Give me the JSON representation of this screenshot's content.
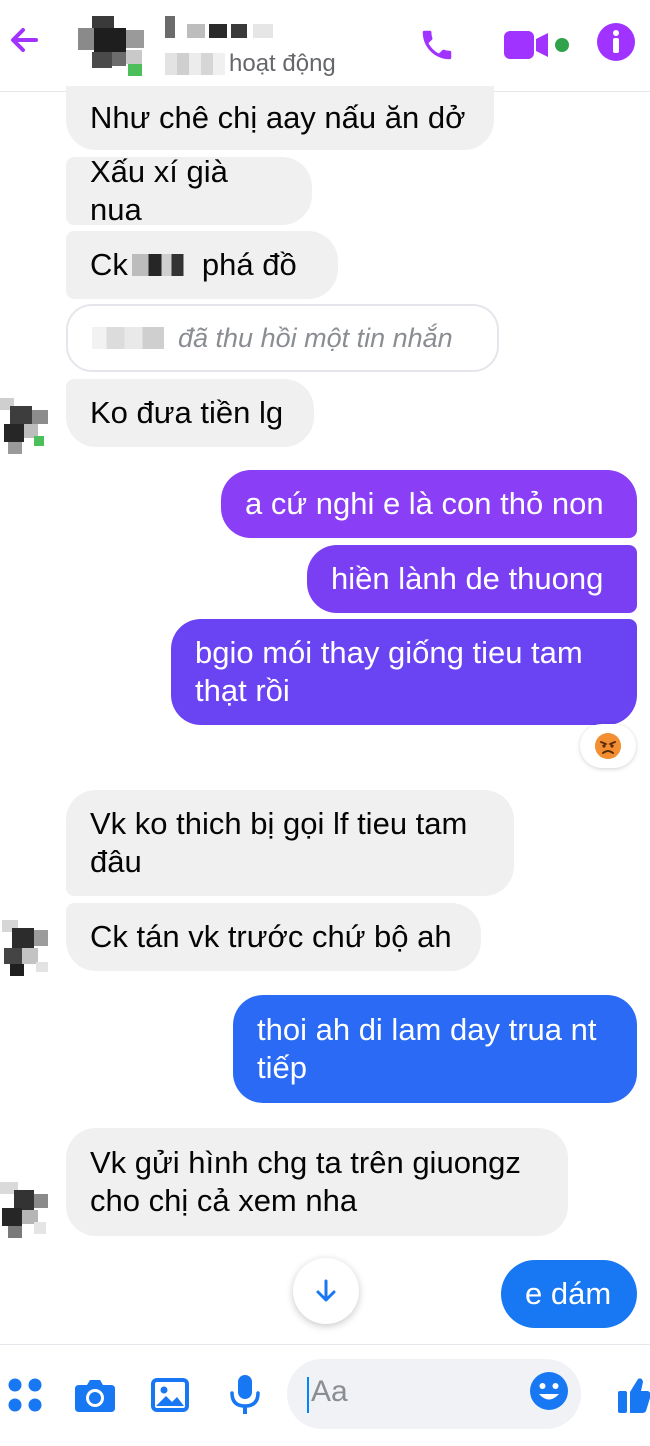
{
  "colors": {
    "accent": "#a033ff",
    "purple_bubble": "#7b3ff2",
    "blue_bubble": "#1877f2",
    "incoming_bubble": "#f0f0f0",
    "online_dot": "#31a24c"
  },
  "header": {
    "status_text": "hoạt động",
    "icons": [
      "back-arrow-icon",
      "phone-icon",
      "video-camera-icon",
      "info-icon"
    ]
  },
  "messages": [
    {
      "id": "m1",
      "direction": "in",
      "text": "Như chê chị aay nấu ăn dở"
    },
    {
      "id": "m2",
      "direction": "in",
      "text": "Xấu xí già nua"
    },
    {
      "id": "m3",
      "direction": "in",
      "prefix": "Ck",
      "suffix": "phá đồ"
    },
    {
      "id": "m4",
      "direction": "recalled",
      "text": "đã thu hồi một tin nhắn"
    },
    {
      "id": "m5",
      "direction": "in",
      "text": "Ko đưa tiền lg"
    },
    {
      "id": "m6",
      "direction": "out",
      "text": "a cứ nghi e là con thỏ non"
    },
    {
      "id": "m7",
      "direction": "out",
      "text": "hiền lành de thuong"
    },
    {
      "id": "m8",
      "direction": "out",
      "line1": "bgio mói thay giống tieu tam",
      "line2": "thạt rồi",
      "reaction": "angry-face-emoji"
    },
    {
      "id": "m9",
      "direction": "in",
      "line1": "Vk ko thich bị gọi lf tieu tam",
      "line2": "đâu"
    },
    {
      "id": "m10",
      "direction": "in",
      "text": "Ck tán vk trước chứ bộ ah"
    },
    {
      "id": "m11",
      "direction": "out",
      "line1": "thoi ah di lam day trua nt",
      "line2": "tiếp"
    },
    {
      "id": "m12",
      "direction": "in",
      "line1": "Vk gửi hình chg ta trên giuongz",
      "line2": "cho chị cả xem nha"
    },
    {
      "id": "m13",
      "direction": "out",
      "text": "e dám"
    }
  ],
  "composer": {
    "placeholder": "Aa",
    "icons": [
      "apps-grid-icon",
      "camera-icon",
      "image-icon",
      "microphone-icon",
      "emoji-icon",
      "thumbs-up-icon"
    ]
  }
}
